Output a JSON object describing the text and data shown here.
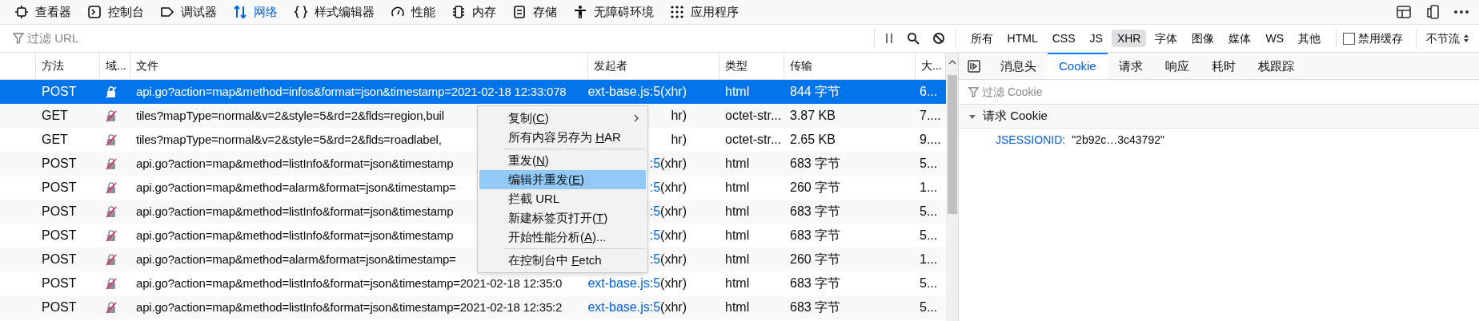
{
  "toolbar": {
    "tabs": [
      {
        "label": "查看器",
        "selected": false
      },
      {
        "label": "控制台",
        "selected": false
      },
      {
        "label": "调试器",
        "selected": false
      },
      {
        "label": "网络",
        "selected": true
      },
      {
        "label": "样式编辑器",
        "selected": false
      },
      {
        "label": "性能",
        "selected": false
      },
      {
        "label": "内存",
        "selected": false
      },
      {
        "label": "存储",
        "selected": false
      },
      {
        "label": "无障碍环境",
        "selected": false
      },
      {
        "label": "应用程序",
        "selected": false
      }
    ]
  },
  "filter_bar": {
    "placeholder": "过滤 URL",
    "types": [
      {
        "label": "所有",
        "selected": false
      },
      {
        "label": "HTML",
        "selected": false
      },
      {
        "label": "CSS",
        "selected": false
      },
      {
        "label": "JS",
        "selected": false
      },
      {
        "label": "XHR",
        "selected": true
      },
      {
        "label": "字体",
        "selected": false
      },
      {
        "label": "图像",
        "selected": false
      },
      {
        "label": "媒体",
        "selected": false
      },
      {
        "label": "WS",
        "selected": false
      },
      {
        "label": "其他",
        "selected": false
      }
    ],
    "disable_cache": {
      "label": "禁用缓存",
      "checked": false
    },
    "throttle": "不节流"
  },
  "table": {
    "columns": [
      "方法",
      "域...",
      "文件",
      "发起者",
      "类型",
      "传输",
      "大..."
    ],
    "rows": [
      {
        "method": "POST",
        "file": "api.go?action=map&method=infos&format=json&timestamp=2021-02-18 12:33:078",
        "initiator": {
          "link": "ext-base.js:5",
          "suffix": " (xhr)"
        },
        "type": "html",
        "transferred": "844 字节",
        "size": "6...",
        "selected": true
      },
      {
        "method": "GET",
        "file": "tiles?mapType=normal&v=2&style=5&rd=2&flds=region,buil",
        "initiator": {
          "suffix": "hr)"
        },
        "type": "octet-str...",
        "transferred": "3.87 KB",
        "size": "7....",
        "selected": false
      },
      {
        "method": "GET",
        "file": "tiles?mapType=normal&v=2&style=5&rd=2&flds=roadlabel,",
        "initiator": {
          "suffix": "hr)"
        },
        "type": "octet-str...",
        "transferred": "2.65 KB",
        "size": "9....",
        "selected": false
      },
      {
        "method": "POST",
        "file": "api.go?action=map&method=listInfo&format=json&timestamp",
        "initiator": {
          "link": ":5",
          "suffix": " (xhr)"
        },
        "type": "html",
        "transferred": "683 字节",
        "size": "5...",
        "selected": false
      },
      {
        "method": "POST",
        "file": "api.go?action=map&method=alarm&format=json&timestamp=",
        "initiator": {
          "link": ":5",
          "suffix": " (xhr)"
        },
        "type": "html",
        "transferred": "260 字节",
        "size": "1...",
        "selected": false
      },
      {
        "method": "POST",
        "file": "api.go?action=map&method=listInfo&format=json&timestamp",
        "initiator": {
          "link": ":5",
          "suffix": " (xhr)"
        },
        "type": "html",
        "transferred": "683 字节",
        "size": "5...",
        "selected": false
      },
      {
        "method": "POST",
        "file": "api.go?action=map&method=listInfo&format=json&timestamp",
        "initiator": {
          "link": ":5",
          "suffix": " (xhr)"
        },
        "type": "html",
        "transferred": "683 字节",
        "size": "5...",
        "selected": false
      },
      {
        "method": "POST",
        "file": "api.go?action=map&method=alarm&format=json&timestamp=",
        "initiator": {
          "link": ":5",
          "suffix": " (xhr)"
        },
        "type": "html",
        "transferred": "260 字节",
        "size": "1...",
        "selected": false
      },
      {
        "method": "POST",
        "file": "api.go?action=map&method=listInfo&format=json&timestamp=2021-02-18 12:35:0",
        "initiator": {
          "link": "ext-base.js:5",
          "suffix": " (xhr)"
        },
        "type": "html",
        "transferred": "683 字节",
        "size": "5...",
        "selected": false
      },
      {
        "method": "POST",
        "file": "api.go?action=map&method=listInfo&format=json&timestamp=2021-02-18 12:35:2",
        "initiator": {
          "link": "ext-base.js:5",
          "suffix": " (xhr)"
        },
        "type": "html",
        "transferred": "683 字节",
        "size": "5...",
        "selected": false
      }
    ]
  },
  "context_menu": [
    {
      "kind": "item",
      "label": "复制(",
      "mnemonic": "C",
      "after": ")",
      "submenu": true,
      "selected": false
    },
    {
      "kind": "item",
      "label": "所有内容另存为 ",
      "mnemonic": "H",
      "after": "AR",
      "submenu": false,
      "selected": false
    },
    {
      "kind": "separator"
    },
    {
      "kind": "item",
      "label": "重发(",
      "mnemonic": "N",
      "after": ")",
      "submenu": false,
      "selected": false
    },
    {
      "kind": "item",
      "label": "编辑并重发(",
      "mnemonic": "E",
      "after": ")",
      "submenu": false,
      "selected": true
    },
    {
      "kind": "item",
      "label": "拦截 URL",
      "submenu": false,
      "selected": false
    },
    {
      "kind": "item",
      "label": "新建标签页打开(",
      "mnemonic": "T",
      "after": ")",
      "submenu": false,
      "selected": false
    },
    {
      "kind": "item",
      "label": "开始性能分析(",
      "mnemonic": "A",
      "after": ")...",
      "submenu": false,
      "selected": false
    },
    {
      "kind": "separator"
    },
    {
      "kind": "item",
      "label": "在控制台中 ",
      "mnemonic": "F",
      "after": "etch",
      "submenu": false,
      "selected": false
    }
  ],
  "details": {
    "tabs": [
      {
        "label": "消息头",
        "selected": false
      },
      {
        "label": "Cookie",
        "selected": true
      },
      {
        "label": "请求",
        "selected": false
      },
      {
        "label": "响应",
        "selected": false
      },
      {
        "label": "耗时",
        "selected": false
      },
      {
        "label": "栈跟踪",
        "selected": false
      }
    ],
    "filter_placeholder": "过滤 Cookie",
    "section": {
      "title": "请求 Cookie",
      "expanded": true,
      "cookies": [
        {
          "name": "JSESSIONID:",
          "value": "\"2b92c…3c43792\""
        }
      ]
    }
  }
}
